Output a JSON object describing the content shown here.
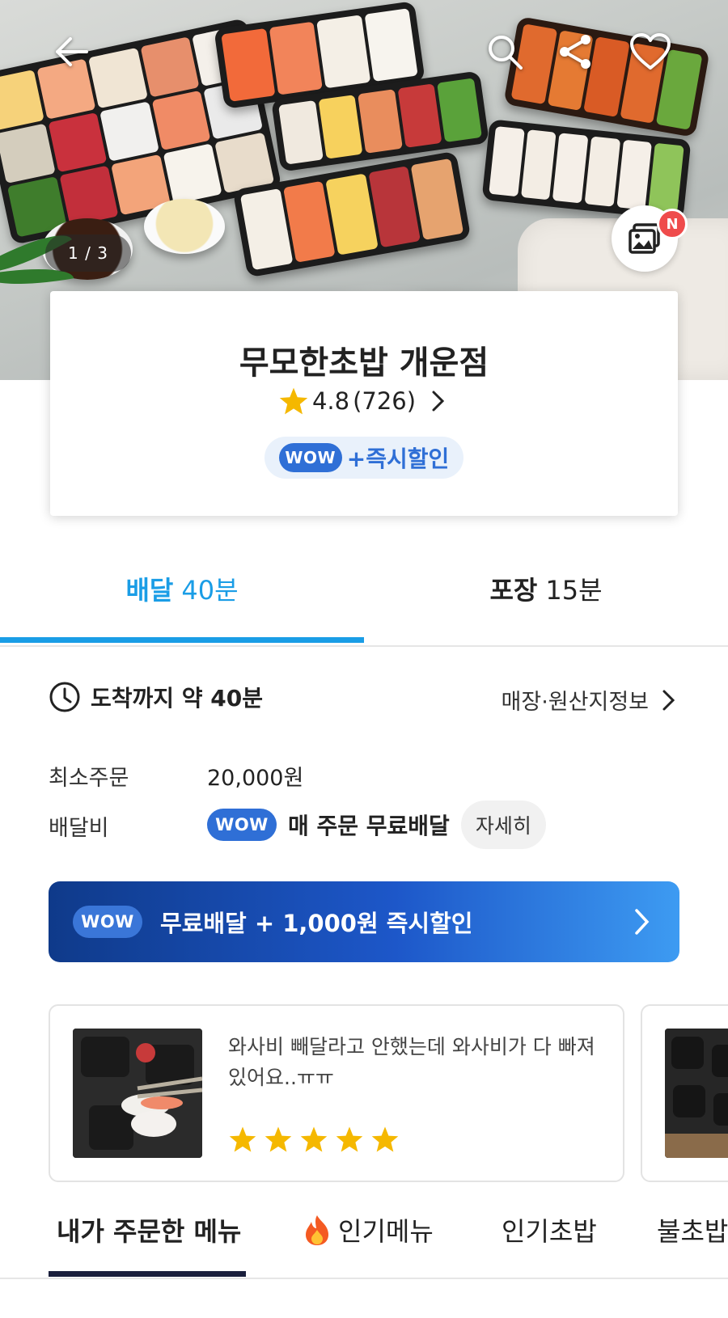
{
  "hero": {
    "image_counter": "1 / 3",
    "new_badge": "N",
    "icons": [
      "back-arrow-icon",
      "search-icon",
      "share-icon",
      "heart-icon",
      "photo-gallery-icon"
    ]
  },
  "store": {
    "name": "무모한초밥 개운점",
    "rating": "4.8",
    "review_count": "(726)",
    "wow_label": "WOW",
    "wow_extra": "+즉시할인"
  },
  "tabs": {
    "delivery": {
      "label": "배달",
      "time": "40분"
    },
    "pickup": {
      "label": "포장",
      "time": "15분"
    }
  },
  "delivery_info": {
    "arrival": "도착까지 약 40분",
    "store_info_link": "매장·원산지정보",
    "min_order_label": "최소주문",
    "min_order_value": "20,000원",
    "fee_label": "배달비",
    "fee_wow": "WOW",
    "fee_text": "매 주문 무료배달",
    "detail_button": "자세히"
  },
  "wow_banner": {
    "badge": "WOW",
    "text": "무료배달 + 1,000원 즉시할인"
  },
  "review": {
    "text": "와사비 빼달라고 안했는데 와사비가 다 빠져있어요..ㅠㅠ",
    "stars": 5
  },
  "menu_tabs": [
    "내가 주문한 메뉴",
    "인기메뉴",
    "인기초밥",
    "불초밥"
  ],
  "colors": {
    "accent": "#1a9de6",
    "wow_blue": "#2f6fd6",
    "star": "#f5b800"
  }
}
